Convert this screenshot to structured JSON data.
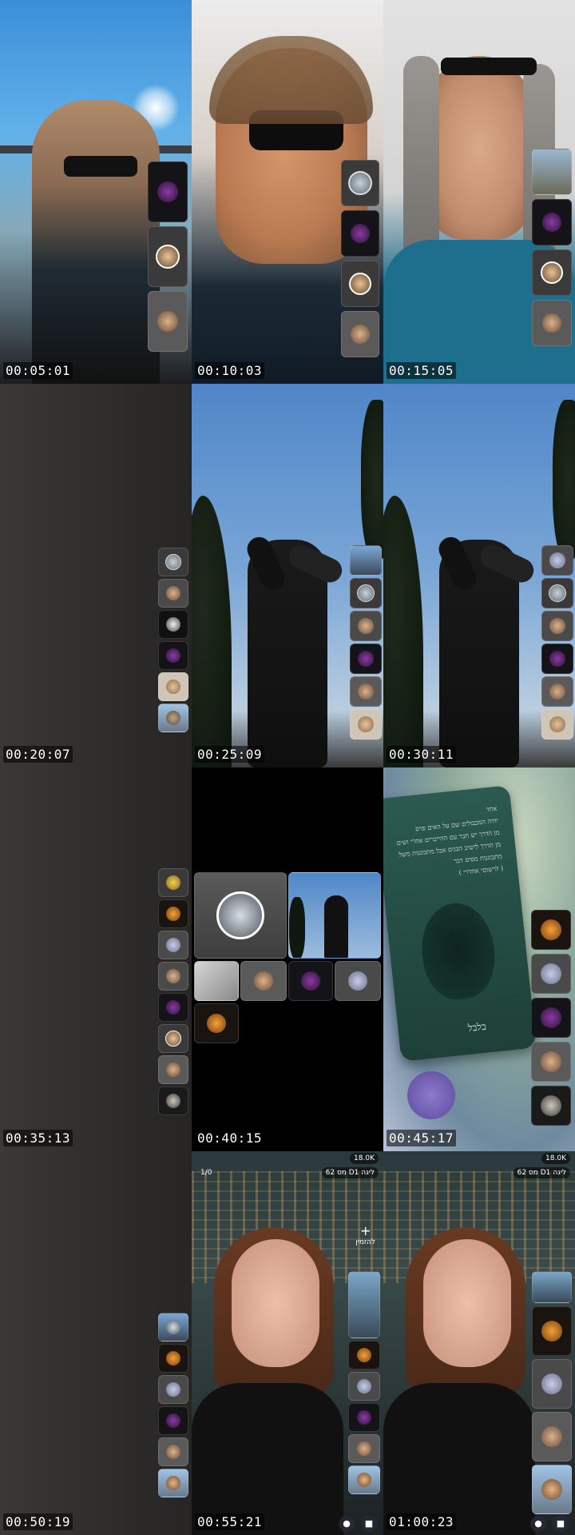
{
  "timestamps": [
    "00:05:01",
    "00:10:03",
    "00:15:05",
    "00:20:07",
    "00:25:09",
    "00:30:11",
    "00:35:13",
    "00:40:15",
    "00:45:17",
    "00:50:19",
    "00:55:21",
    "01:00:23"
  ],
  "card": {
    "lines": [
      "אחד",
      "יהיה המכבולים שם על האים פרס",
      "מן הדרך יש חבר עם ההייברים אחרי ושים",
      "מן הדרך לישיב הבנים אבל מתבוננות משל",
      "מתבוננות מסים דבר",
      "( לרשוםי אחדרי )"
    ],
    "footer": "בלבל"
  },
  "live": {
    "viewers": "18.0K",
    "rank_badge": "62 מס D1 ליגה",
    "counter": "1/0",
    "invite_label": "להזמין",
    "plus_symbol": "+"
  },
  "colors": {
    "sky": "#3f8fd4",
    "teal": "#1f6c8a",
    "card": "#244a42",
    "dark_panel": "#2f2f30"
  }
}
